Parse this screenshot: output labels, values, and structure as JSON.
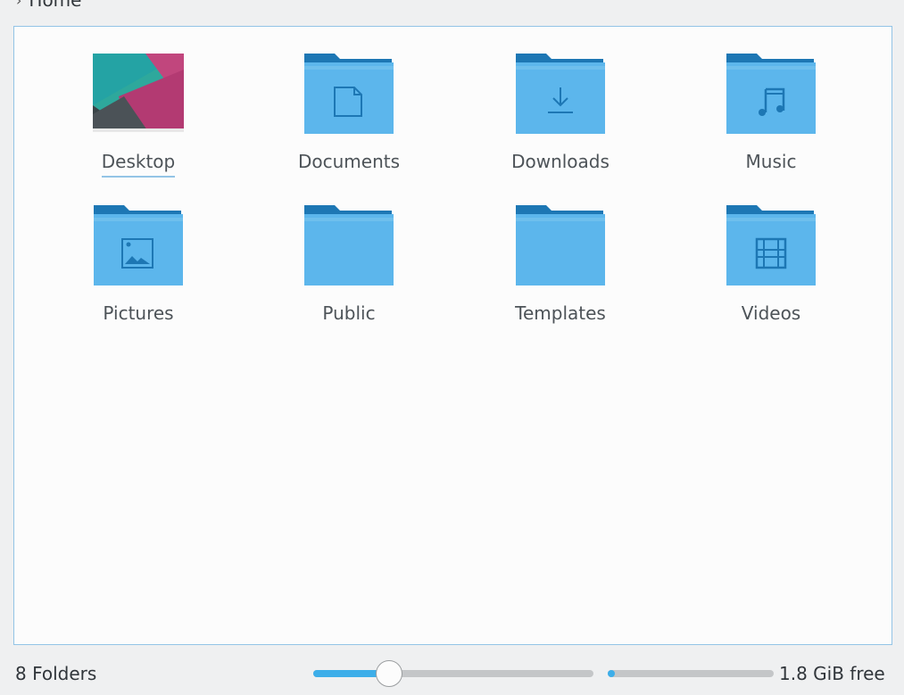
{
  "breadcrumb": {
    "separator_icon": "chevron-right-icon",
    "current": "Home"
  },
  "folders": [
    {
      "name": "Desktop",
      "icon": "desktop-wallpaper-icon",
      "focused": true
    },
    {
      "name": "Documents",
      "icon": "folder-documents-icon"
    },
    {
      "name": "Downloads",
      "icon": "folder-downloads-icon"
    },
    {
      "name": "Music",
      "icon": "folder-music-icon"
    },
    {
      "name": "Pictures",
      "icon": "folder-pictures-icon"
    },
    {
      "name": "Public",
      "icon": "folder-icon"
    },
    {
      "name": "Templates",
      "icon": "folder-icon"
    },
    {
      "name": "Videos",
      "icon": "folder-videos-icon"
    }
  ],
  "statusbar": {
    "item_count": "8 Folders",
    "zoom_level_fraction": 0.27,
    "disk_usage_fraction": 0.04,
    "free_space": "1.8 GiB free"
  },
  "colors": {
    "accent": "#3daee9",
    "folder_body": "#5cb6ec",
    "folder_tab": "#1d77b4",
    "focus_underline": "#93c4e6"
  }
}
